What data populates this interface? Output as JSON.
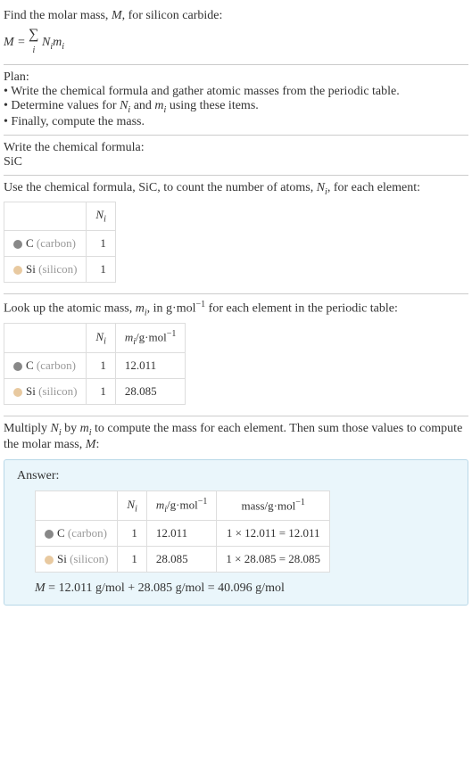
{
  "intro": {
    "line1": "Find the molar mass, ",
    "line1_var": "M",
    "line1_end": ", for silicon carbide:",
    "formula_lhs": "M",
    "formula_eq": " = ",
    "formula_sum": "∑",
    "formula_sub": "i",
    "formula_rhs1": "N",
    "formula_rhs1_sub": "i",
    "formula_rhs2": "m",
    "formula_rhs2_sub": "i"
  },
  "plan": {
    "title": "Plan:",
    "b1": "• Write the chemical formula and gather atomic masses from the periodic table.",
    "b2_a": "• Determine values for ",
    "b2_ni": "N",
    "b2_ni_sub": "i",
    "b2_b": " and ",
    "b2_mi": "m",
    "b2_mi_sub": "i",
    "b2_c": " using these items.",
    "b3": "• Finally, compute the mass."
  },
  "chemformula": {
    "title": "Write the chemical formula:",
    "value": "SiC"
  },
  "count": {
    "text_a": "Use the chemical formula, SiC, to count the number of atoms, ",
    "text_ni": "N",
    "text_ni_sub": "i",
    "text_b": ", for each element:",
    "hdr_ni": "N",
    "hdr_ni_sub": "i",
    "row_c_elem": "C",
    "row_c_label": " (carbon)",
    "row_c_n": "1",
    "row_si_elem": "Si",
    "row_si_label": " (silicon)",
    "row_si_n": "1"
  },
  "lookup": {
    "text_a": "Look up the atomic mass, ",
    "text_mi": "m",
    "text_mi_sub": "i",
    "text_b": ", in g·mol",
    "text_exp": "−1",
    "text_c": " for each element in the periodic table:",
    "hdr_ni": "N",
    "hdr_ni_sub": "i",
    "hdr_mi": "m",
    "hdr_mi_sub": "i",
    "hdr_mi_unit": "/g·mol",
    "hdr_mi_exp": "−1",
    "row_c_elem": "C",
    "row_c_label": " (carbon)",
    "row_c_n": "1",
    "row_c_m": "12.011",
    "row_si_elem": "Si",
    "row_si_label": " (silicon)",
    "row_si_n": "1",
    "row_si_m": "28.085"
  },
  "multiply": {
    "text_a": "Multiply ",
    "text_ni": "N",
    "text_ni_sub": "i",
    "text_b": " by ",
    "text_mi": "m",
    "text_mi_sub": "i",
    "text_c": " to compute the mass for each element. Then sum those values to compute the molar mass, ",
    "text_M": "M",
    "text_d": ":"
  },
  "answer": {
    "label": "Answer:",
    "hdr_ni": "N",
    "hdr_ni_sub": "i",
    "hdr_mi": "m",
    "hdr_mi_sub": "i",
    "hdr_mi_unit": "/g·mol",
    "hdr_mi_exp": "−1",
    "hdr_mass": "mass/g·mol",
    "hdr_mass_exp": "−1",
    "row_c_elem": "C",
    "row_c_label": " (carbon)",
    "row_c_n": "1",
    "row_c_m": "12.011",
    "row_c_mass": "1 × 12.011 = 12.011",
    "row_si_elem": "Si",
    "row_si_label": " (silicon)",
    "row_si_n": "1",
    "row_si_m": "28.085",
    "row_si_mass": "1 × 28.085 = 28.085",
    "final_lhs": "M",
    "final_rhs": " = 12.011 g/mol + 28.085 g/mol = 40.096 g/mol"
  }
}
